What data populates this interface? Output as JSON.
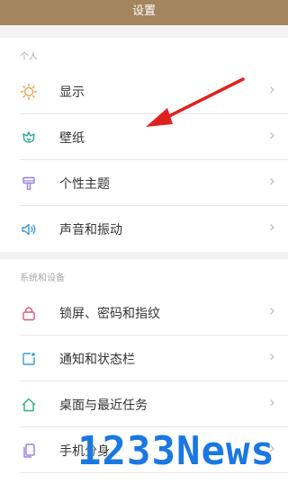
{
  "title": "设置",
  "sections": [
    {
      "header": "个人",
      "items": [
        {
          "label": "显示",
          "icon": "brightness-icon"
        },
        {
          "label": "壁纸",
          "icon": "wallpaper-icon"
        },
        {
          "label": "个性主题",
          "icon": "theme-icon"
        },
        {
          "label": "声音和振动",
          "icon": "speaker-icon"
        }
      ]
    },
    {
      "header": "系统和设备",
      "items": [
        {
          "label": "锁屏、密码和指纹",
          "icon": "lock-icon"
        },
        {
          "label": "通知和状态栏",
          "icon": "notification-icon"
        },
        {
          "label": "桌面与最近任务",
          "icon": "home-icon"
        },
        {
          "label": "手机分身",
          "icon": "dual-phone-icon"
        }
      ]
    }
  ],
  "watermark": "1233News",
  "colors": {
    "titlebar": "#a3855e",
    "arrow": "#e02020",
    "watermark": "#1a78e0"
  }
}
